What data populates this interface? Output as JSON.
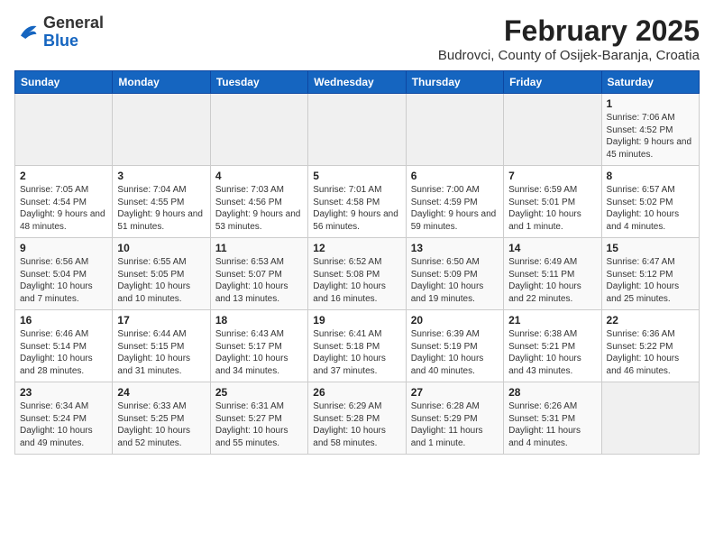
{
  "header": {
    "logo_general": "General",
    "logo_blue": "Blue",
    "month_title": "February 2025",
    "location": "Budrovci, County of Osijek-Baranja, Croatia"
  },
  "weekdays": [
    "Sunday",
    "Monday",
    "Tuesday",
    "Wednesday",
    "Thursday",
    "Friday",
    "Saturday"
  ],
  "weeks": [
    [
      {
        "day": "",
        "info": ""
      },
      {
        "day": "",
        "info": ""
      },
      {
        "day": "",
        "info": ""
      },
      {
        "day": "",
        "info": ""
      },
      {
        "day": "",
        "info": ""
      },
      {
        "day": "",
        "info": ""
      },
      {
        "day": "1",
        "info": "Sunrise: 7:06 AM\nSunset: 4:52 PM\nDaylight: 9 hours and 45 minutes."
      }
    ],
    [
      {
        "day": "2",
        "info": "Sunrise: 7:05 AM\nSunset: 4:54 PM\nDaylight: 9 hours and 48 minutes."
      },
      {
        "day": "3",
        "info": "Sunrise: 7:04 AM\nSunset: 4:55 PM\nDaylight: 9 hours and 51 minutes."
      },
      {
        "day": "4",
        "info": "Sunrise: 7:03 AM\nSunset: 4:56 PM\nDaylight: 9 hours and 53 minutes."
      },
      {
        "day": "5",
        "info": "Sunrise: 7:01 AM\nSunset: 4:58 PM\nDaylight: 9 hours and 56 minutes."
      },
      {
        "day": "6",
        "info": "Sunrise: 7:00 AM\nSunset: 4:59 PM\nDaylight: 9 hours and 59 minutes."
      },
      {
        "day": "7",
        "info": "Sunrise: 6:59 AM\nSunset: 5:01 PM\nDaylight: 10 hours and 1 minute."
      },
      {
        "day": "8",
        "info": "Sunrise: 6:57 AM\nSunset: 5:02 PM\nDaylight: 10 hours and 4 minutes."
      }
    ],
    [
      {
        "day": "9",
        "info": "Sunrise: 6:56 AM\nSunset: 5:04 PM\nDaylight: 10 hours and 7 minutes."
      },
      {
        "day": "10",
        "info": "Sunrise: 6:55 AM\nSunset: 5:05 PM\nDaylight: 10 hours and 10 minutes."
      },
      {
        "day": "11",
        "info": "Sunrise: 6:53 AM\nSunset: 5:07 PM\nDaylight: 10 hours and 13 minutes."
      },
      {
        "day": "12",
        "info": "Sunrise: 6:52 AM\nSunset: 5:08 PM\nDaylight: 10 hours and 16 minutes."
      },
      {
        "day": "13",
        "info": "Sunrise: 6:50 AM\nSunset: 5:09 PM\nDaylight: 10 hours and 19 minutes."
      },
      {
        "day": "14",
        "info": "Sunrise: 6:49 AM\nSunset: 5:11 PM\nDaylight: 10 hours and 22 minutes."
      },
      {
        "day": "15",
        "info": "Sunrise: 6:47 AM\nSunset: 5:12 PM\nDaylight: 10 hours and 25 minutes."
      }
    ],
    [
      {
        "day": "16",
        "info": "Sunrise: 6:46 AM\nSunset: 5:14 PM\nDaylight: 10 hours and 28 minutes."
      },
      {
        "day": "17",
        "info": "Sunrise: 6:44 AM\nSunset: 5:15 PM\nDaylight: 10 hours and 31 minutes."
      },
      {
        "day": "18",
        "info": "Sunrise: 6:43 AM\nSunset: 5:17 PM\nDaylight: 10 hours and 34 minutes."
      },
      {
        "day": "19",
        "info": "Sunrise: 6:41 AM\nSunset: 5:18 PM\nDaylight: 10 hours and 37 minutes."
      },
      {
        "day": "20",
        "info": "Sunrise: 6:39 AM\nSunset: 5:19 PM\nDaylight: 10 hours and 40 minutes."
      },
      {
        "day": "21",
        "info": "Sunrise: 6:38 AM\nSunset: 5:21 PM\nDaylight: 10 hours and 43 minutes."
      },
      {
        "day": "22",
        "info": "Sunrise: 6:36 AM\nSunset: 5:22 PM\nDaylight: 10 hours and 46 minutes."
      }
    ],
    [
      {
        "day": "23",
        "info": "Sunrise: 6:34 AM\nSunset: 5:24 PM\nDaylight: 10 hours and 49 minutes."
      },
      {
        "day": "24",
        "info": "Sunrise: 6:33 AM\nSunset: 5:25 PM\nDaylight: 10 hours and 52 minutes."
      },
      {
        "day": "25",
        "info": "Sunrise: 6:31 AM\nSunset: 5:27 PM\nDaylight: 10 hours and 55 minutes."
      },
      {
        "day": "26",
        "info": "Sunrise: 6:29 AM\nSunset: 5:28 PM\nDaylight: 10 hours and 58 minutes."
      },
      {
        "day": "27",
        "info": "Sunrise: 6:28 AM\nSunset: 5:29 PM\nDaylight: 11 hours and 1 minute."
      },
      {
        "day": "28",
        "info": "Sunrise: 6:26 AM\nSunset: 5:31 PM\nDaylight: 11 hours and 4 minutes."
      },
      {
        "day": "",
        "info": ""
      }
    ]
  ]
}
